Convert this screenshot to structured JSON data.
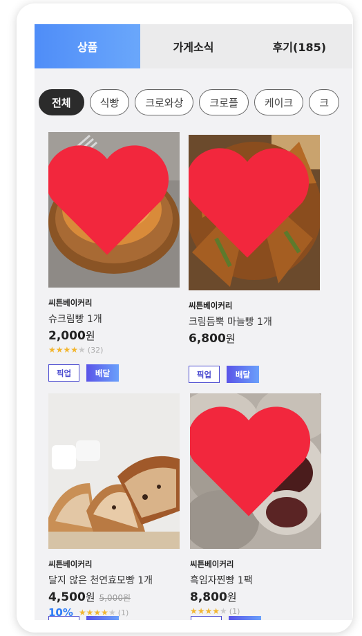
{
  "tabs": [
    {
      "label": "상품",
      "active": true
    },
    {
      "label": "가게소식",
      "active": false
    },
    {
      "label": "후기(185)",
      "active": false
    }
  ],
  "categories": [
    {
      "label": "전체",
      "active": true
    },
    {
      "label": "식빵",
      "active": false
    },
    {
      "label": "크로와상",
      "active": false
    },
    {
      "label": "크로플",
      "active": false
    },
    {
      "label": "케이크",
      "active": false
    },
    {
      "label": "크",
      "active": false
    }
  ],
  "products": [
    {
      "store": "씨튼베이커리",
      "name": "슈크림빵 1개",
      "price": "2,000",
      "currency": "원",
      "rating": 4,
      "review_count": "(32)",
      "favorited": true,
      "buttons": {
        "pickup": "픽업",
        "delivery": "배달"
      }
    },
    {
      "store": "씨튼베이커리",
      "name": "크림듬뿍 마늘빵 1개",
      "price": "6,800",
      "currency": "원",
      "favorited": true,
      "buttons": {
        "pickup": "픽업",
        "delivery": "배달"
      }
    },
    {
      "store": "씨튼베이커리",
      "name": "달지 않은 천연효모빵 1개",
      "price": "4,500",
      "currency": "원",
      "original_price": "5,000원",
      "discount": "10%",
      "rating": 4,
      "review_count": "(1)",
      "favorited": false
    },
    {
      "store": "씨튼베이커리",
      "name": "흑임자찐빵 1팩",
      "price": "8,800",
      "currency": "원",
      "rating": 4,
      "review_count": "(1)",
      "favorited": true
    }
  ],
  "colors": {
    "accent": "#4f8df8",
    "heart": "#f2273d",
    "discount": "#2f7df6",
    "star": "#f2b630"
  }
}
